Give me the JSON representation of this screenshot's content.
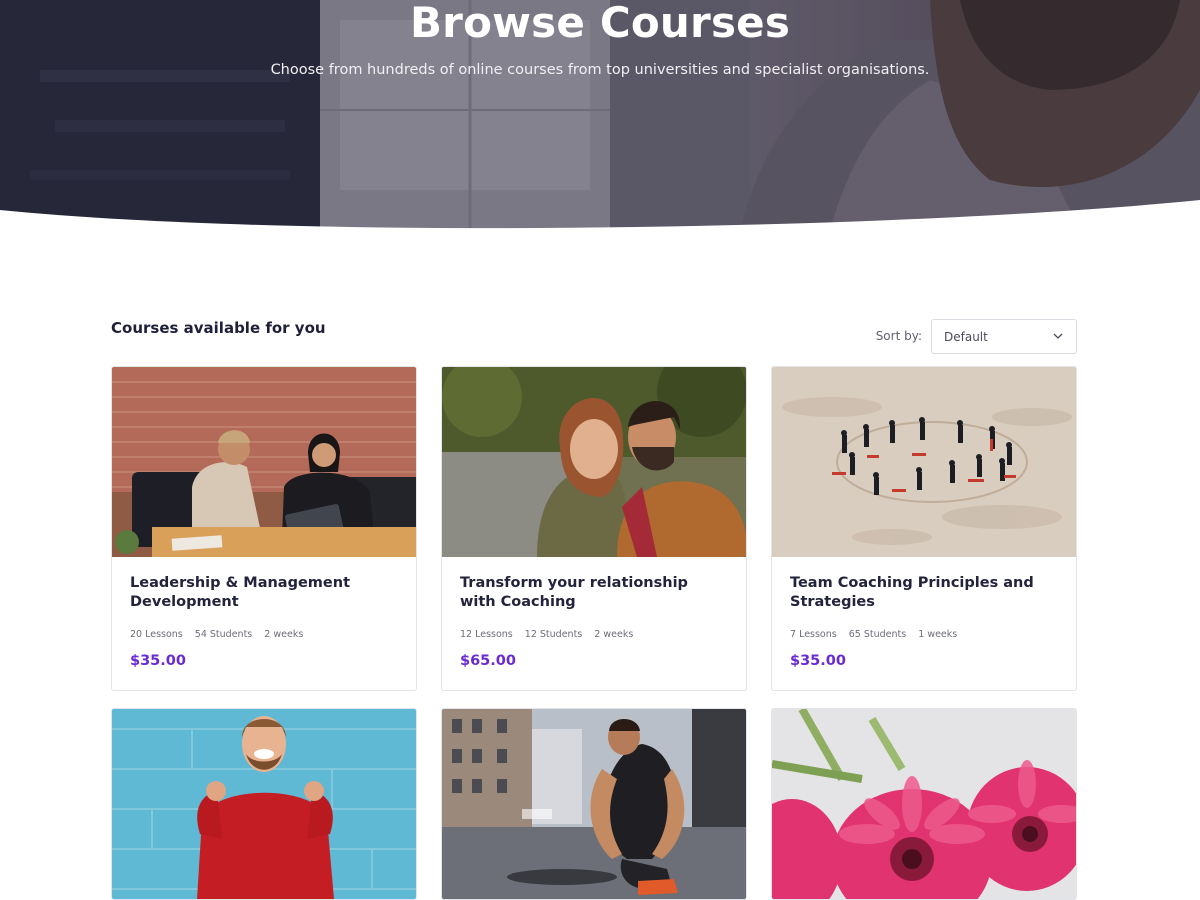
{
  "hero": {
    "title": "Browse Courses",
    "subtitle": "Choose from hundreds of online courses from top universities and specialist organisations."
  },
  "toolbar": {
    "section_title": "Courses available for you",
    "sort_label": "Sort by:",
    "sort_value": "Default"
  },
  "colors": {
    "price": "#6a2bd1",
    "title": "#23233d"
  },
  "courses": [
    {
      "title": "Leadership & Management Development",
      "lessons": "20 Lessons",
      "students": "54 Students",
      "duration": "2 weeks",
      "price": "$35.00",
      "image": "office-meeting-photo"
    },
    {
      "title": "Transform your relationship with Coaching",
      "lessons": "12 Lessons",
      "students": "12 Students",
      "duration": "2 weeks",
      "price": "$65.00",
      "image": "couple-photo"
    },
    {
      "title": "Team Coaching Principles and Strategies",
      "lessons": "7 Lessons",
      "students": "65 Students",
      "duration": "1 weeks",
      "price": "$35.00",
      "image": "beach-team-circle-photo"
    },
    {
      "title": "",
      "image": "happy-man-red-sweater-photo"
    },
    {
      "title": "",
      "image": "runner-tying-shoe-photo"
    },
    {
      "title": "",
      "image": "pink-gerbera-flowers-photo"
    }
  ]
}
